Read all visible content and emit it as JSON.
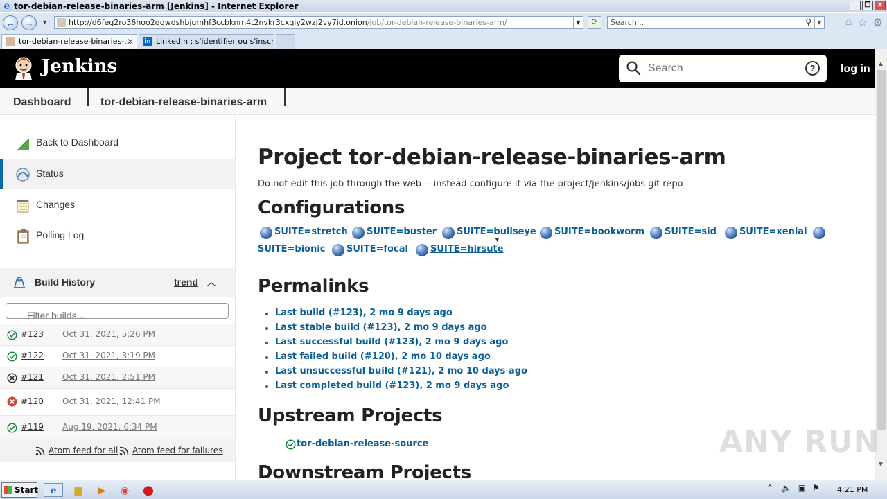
{
  "window": {
    "title": "tor-debian-release-binaries-arm [Jenkins] - Internet Explorer",
    "controls": [
      "_",
      "❐",
      "✕"
    ]
  },
  "browser": {
    "url_main": "http://d6feg2ro36hoo2qqwdshbjumhf3ccbknm4t2nvkr3cxqiy2wzj2vy7id.onion",
    "url_path": "/job/tor-debian-release-binaries-arm/",
    "search_placeholder": "Search...",
    "tabs": [
      {
        "label": "tor-debian-release-binaries-...",
        "active": true
      },
      {
        "label": "LinkedIn : s'identifier ou s'inscrire",
        "active": false
      }
    ]
  },
  "jenkins": {
    "brand": "Jenkins",
    "search_placeholder": "Search",
    "help": "?",
    "login": "log in",
    "breadcrumbs": [
      "Dashboard",
      "tor-debian-release-binaries-arm"
    ]
  },
  "sidebar": {
    "items": [
      {
        "label": "Back to Dashboard",
        "icon": "back-arrow-icon"
      },
      {
        "label": "Status",
        "icon": "status-icon",
        "active": true
      },
      {
        "label": "Changes",
        "icon": "notepad-icon"
      },
      {
        "label": "Polling Log",
        "icon": "clipboard-icon"
      }
    ],
    "build_history": {
      "title": "Build History",
      "trend": "trend",
      "filter_placeholder": "Filter builds...",
      "builds": [
        {
          "number": "#123",
          "date": "Oct 31, 2021, 5:26 PM",
          "status": "success"
        },
        {
          "number": "#122",
          "date": "Oct 31, 2021, 3:19 PM",
          "status": "success"
        },
        {
          "number": "#121",
          "date": "Oct 31, 2021, 2:51 PM",
          "status": "aborted"
        },
        {
          "number": "#120",
          "date": "Oct 31, 2021, 12:41 PM",
          "status": "failed"
        },
        {
          "number": "#119",
          "date": "Aug 19, 2021, 6:34 PM",
          "status": "success"
        }
      ],
      "feed_all": "Atom feed for all",
      "feed_failures": "Atom feed for failures"
    }
  },
  "main": {
    "title": "Project tor-debian-release-binaries-arm",
    "description": "Do not edit this job through the web -- instead configure it via the project/jenkins/jobs git repo",
    "configurations_heading": "Configurations",
    "configurations": [
      "SUITE=stretch",
      "SUITE=buster",
      "SUITE=bullseye",
      "SUITE=bookworm",
      "SUITE=sid",
      "SUITE=xenial",
      "SUITE=bionic",
      "SUITE=focal",
      "SUITE=hirsute"
    ],
    "permalinks_heading": "Permalinks",
    "permalinks": [
      "Last build (#123), 2 mo 9 days ago",
      "Last stable build (#123), 2 mo 9 days ago",
      "Last successful build (#123), 2 mo 9 days ago",
      "Last failed build (#120), 2 mo 10 days ago",
      "Last unsuccessful build (#121), 2 mo 10 days ago",
      "Last completed build (#123), 2 mo 9 days ago"
    ],
    "upstream_heading": "Upstream Projects",
    "upstream_projects": [
      "tor-debian-release-source"
    ],
    "downstream_heading": "Downstream Projects"
  },
  "watermark": "ANY RUN",
  "taskbar": {
    "start": "Start",
    "clock": "4:21 PM"
  },
  "colors": {
    "link": "#0b5f96",
    "header_bg": "#000000",
    "success": "#138a36",
    "failed": "#d24939"
  }
}
